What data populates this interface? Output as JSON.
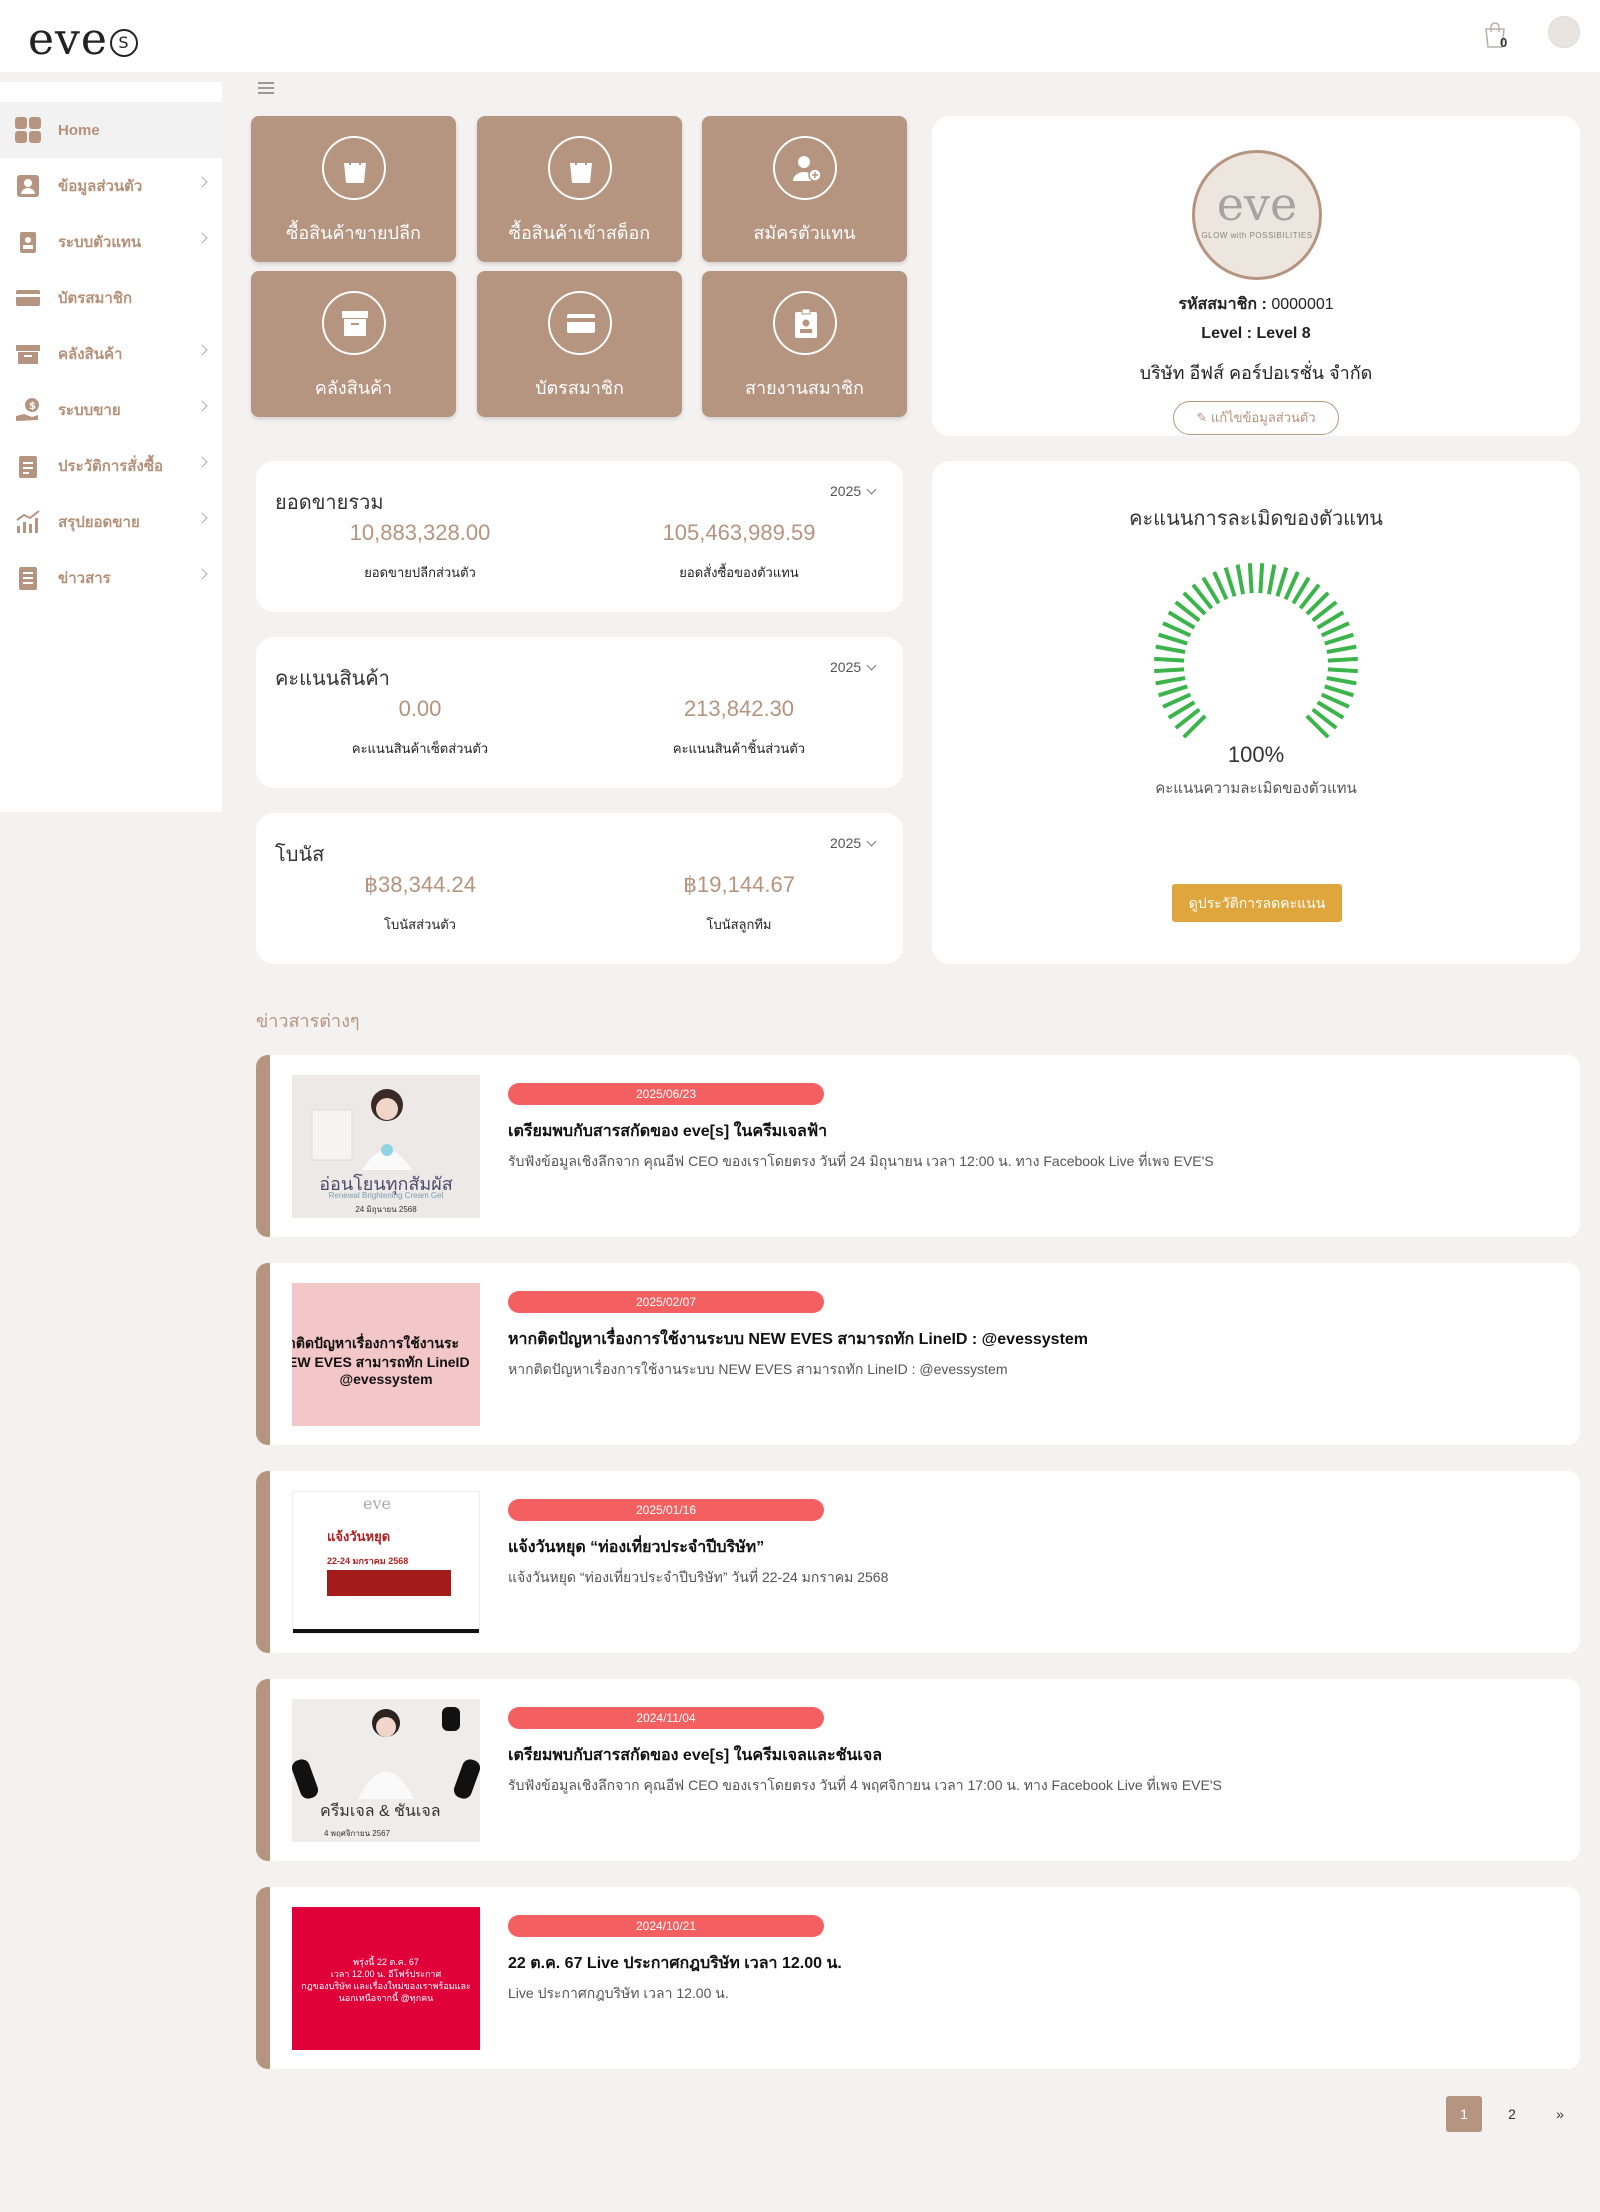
{
  "header": {
    "logo_text": "eve",
    "logo_s": "S",
    "cart_count": "0"
  },
  "sidebar": {
    "items": [
      {
        "label": "Home",
        "icon": "home-grid-icon"
      },
      {
        "label": "ข้อมูลส่วนตัว",
        "icon": "profile-icon"
      },
      {
        "label": "ระบบตัวแทน",
        "icon": "agent-badge-icon"
      },
      {
        "label": "บัตรสมาชิก",
        "icon": "member-card-icon"
      },
      {
        "label": "คลังสินค้า",
        "icon": "warehouse-box-icon"
      },
      {
        "label": "ระบบขาย",
        "icon": "sales-hand-coin-icon"
      },
      {
        "label": "ประวัติการสั่งซื้อ",
        "icon": "order-clipboard-icon"
      },
      {
        "label": "สรุปยอดขาย",
        "icon": "sales-chart-icon"
      },
      {
        "label": "ข่าวสาร",
        "icon": "news-document-icon"
      }
    ]
  },
  "tiles": [
    {
      "label": "ซื้อสินค้าขายปลีก",
      "icon": "shopping-bag-icon"
    },
    {
      "label": "ซื้อสินค้าเข้าสต็อก",
      "icon": "shopping-bag-icon"
    },
    {
      "label": "สมัครตัวแทน",
      "icon": "add-user-icon"
    },
    {
      "label": "คลังสินค้า",
      "icon": "archive-box-icon"
    },
    {
      "label": "บัตรสมาชิก",
      "icon": "card-icon"
    },
    {
      "label": "สายงานสมาชิก",
      "icon": "clipboard-user-icon"
    }
  ],
  "profile": {
    "logo_word": "eve",
    "logo_tagline": "GLOW with POSSIBILITIES",
    "member_id_label": "รหัสสมาชิก :",
    "member_id": "0000001",
    "level_label": "Level :",
    "level": "Level 8",
    "company": "บริษัท อีฟส์ คอร์ปอเรชั่น จำกัด",
    "edit_label": "แก้ไขข้อมูลส่วนตัว"
  },
  "sales": {
    "title": "ยอดขายรวม",
    "year": "2025",
    "left_value": "10,883,328.00",
    "left_label": "ยอดขายปลีกส่วนตัว",
    "right_value": "105,463,989.59",
    "right_label": "ยอดสั่งซื้อของตัวแทน"
  },
  "points": {
    "title": "คะแนนสินค้า",
    "year": "2025",
    "left_value": "0.00",
    "left_label": "คะแนนสินค้าเซ็ตส่วนตัว",
    "right_value": "213,842.30",
    "right_label": "คะแนนสินค้าชิ้นส่วนตัว"
  },
  "bonus": {
    "title": "โบนัส",
    "year": "2025",
    "left_value": "฿38,344.24",
    "left_label": "โบนัสส่วนตัว",
    "right_value": "฿19,144.67",
    "right_label": "โบนัสลูกทีม"
  },
  "gauge": {
    "title": "คะแนนการละเมิดของตัวแทน",
    "percent_text": "100%",
    "percent": 100,
    "subtitle": "คะแนนความละเมิดของตัวแทน",
    "button_label": "ดูประวัติการลดคะแนน",
    "color": "#3cb44b"
  },
  "news": {
    "heading": "ข่าวสารต่างๆ",
    "items": [
      {
        "date": "2025/06/23",
        "title": "เตรียมพบกับสารสกัดของ eve[s] ในครีมเจลฟ้า",
        "desc": "รับฟังข้อมูลเชิงลึกจาก คุณอีฟ CEO ของเราโดยตรง วันที่ 24 มิถุนายน เวลา 12:00 น. ทาง Facebook Live ที่เพจ EVE'S",
        "thumb_lines": [
          "อ่อนโยนทุกสัมผัส",
          "Renewal Brightening Cream Gel",
          "24 มิถุนายน 2568"
        ]
      },
      {
        "date": "2025/02/07",
        "title": "หากติดปัญหาเรื่องการใช้งานระบบ NEW EVES สามารถทัก LineID : @evessystem",
        "desc": "หากติดปัญหาเรื่องการใช้งานระบบ NEW EVES สามารถทัก LineID : @evessystem",
        "thumb_lines": [
          "าติดปัญหาเรื่องการใช้งานระ",
          "EW EVES  สามารถทัก LineID",
          "@evessystem"
        ]
      },
      {
        "date": "2025/01/16",
        "title": "แจ้งวันหยุด “ท่องเที่ยวประจำปีบริษัท”",
        "desc": "แจ้งวันหยุด “ท่องเที่ยวประจำปีบริษัท” วันที่ 22-24 มกราคม 2568",
        "thumb_lines": [
          "แจ้งวันหยุด",
          "22-24 มกราคม 2568"
        ]
      },
      {
        "date": "2024/11/04",
        "title": "เตรียมพบกับสารสกัดของ eve[s] ในครีมเจลและชันเจล",
        "desc": "รับฟังข้อมูลเชิงลึกจาก คุณอีฟ CEO ของเราโดยตรง วันที่ 4 พฤศจิกายน เวลา 17:00 น. ทาง Facebook Live ที่เพจ EVE'S",
        "thumb_lines": [
          "ครีมเจล & ชันเจล",
          "4 พฤศจิกายน 2567"
        ]
      },
      {
        "date": "2024/10/21",
        "title": "22 ต.ค. 67 Live ประกาศกฎบริษัท เวลา 12.00 น.",
        "desc": "Live ประกาศกฎบริษัท เวลา 12.00 น.",
        "thumb_lines": [
          "พรุ่งนี้ 22 ต.ค. 67",
          "เวลา 12.00 น. อีโฟร์ประกาศ",
          "กฎของบริษัท และเรื่องใหม่ของเราพร้อมและ",
          "นอกเหนือจากนี้ @ทุกคน"
        ]
      }
    ]
  },
  "pagination": {
    "pages": [
      "1",
      "2"
    ],
    "next": "»"
  }
}
